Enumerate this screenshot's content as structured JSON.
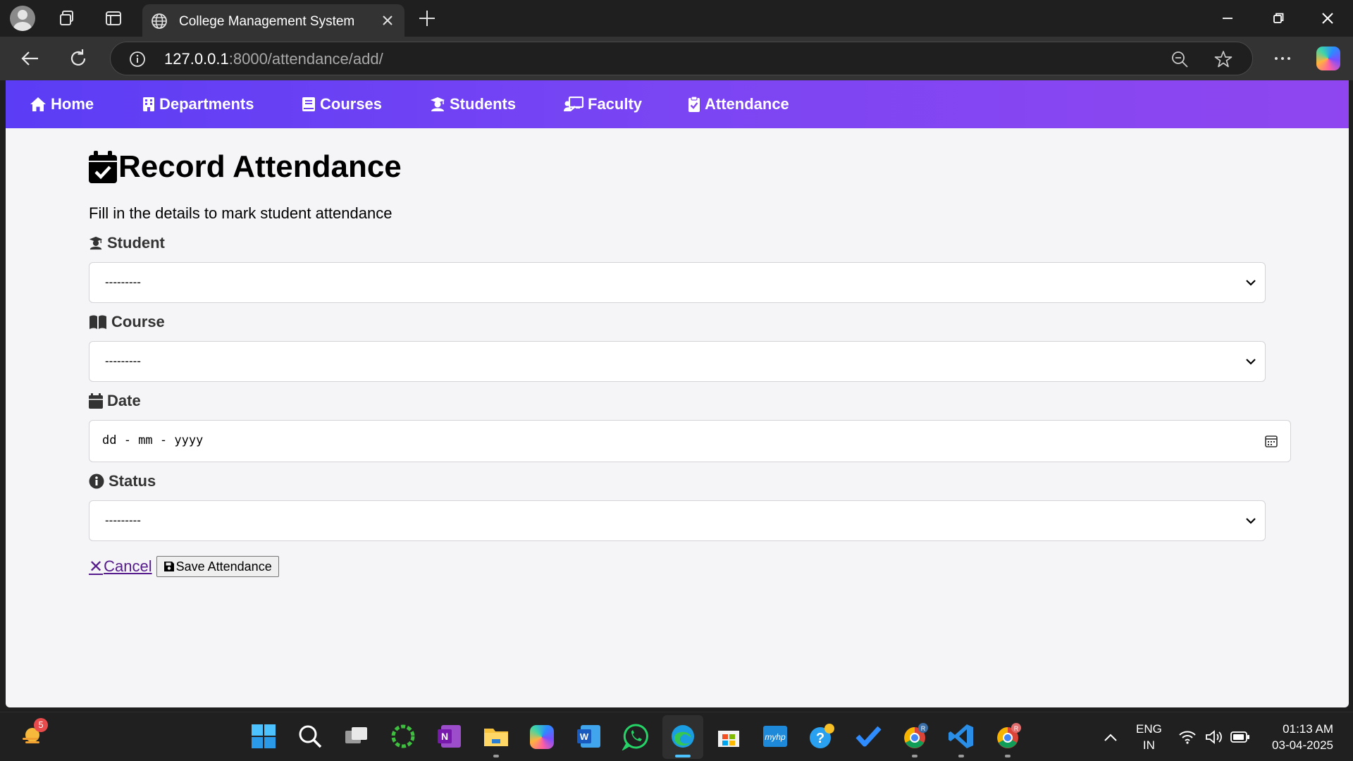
{
  "browser": {
    "tab_title": "College Management System",
    "url_host": "127.0.0.1",
    "url_rest": ":8000/attendance/add/"
  },
  "nav": {
    "items": [
      {
        "label": "Home",
        "icon": "home-icon"
      },
      {
        "label": "Departments",
        "icon": "building-icon"
      },
      {
        "label": "Courses",
        "icon": "book-icon"
      },
      {
        "label": "Students",
        "icon": "graduate-icon"
      },
      {
        "label": "Faculty",
        "icon": "teacher-icon"
      },
      {
        "label": "Attendance",
        "icon": "clipboard-check-icon"
      }
    ]
  },
  "page": {
    "title": "Record Attendance",
    "description": "Fill in the details to mark student attendance"
  },
  "form": {
    "student": {
      "label": "Student",
      "value": "---------"
    },
    "course": {
      "label": "Course",
      "value": "---------"
    },
    "date": {
      "label": "Date",
      "placeholder": "dd - mm - yyyy"
    },
    "status": {
      "label": "Status",
      "value": "---------"
    },
    "cancel_label": "Cancel",
    "cancel_symbol": "✕",
    "save_label": "Save Attendance"
  },
  "taskbar": {
    "notification_count": "5",
    "lang_line1": "ENG",
    "lang_line2": "IN",
    "time": "01:13 AM",
    "date": "03-04-2025"
  },
  "colors": {
    "nav_gradient_start": "#5b3df5",
    "nav_gradient_end": "#8f46f0",
    "link_visited": "#551a8b"
  }
}
